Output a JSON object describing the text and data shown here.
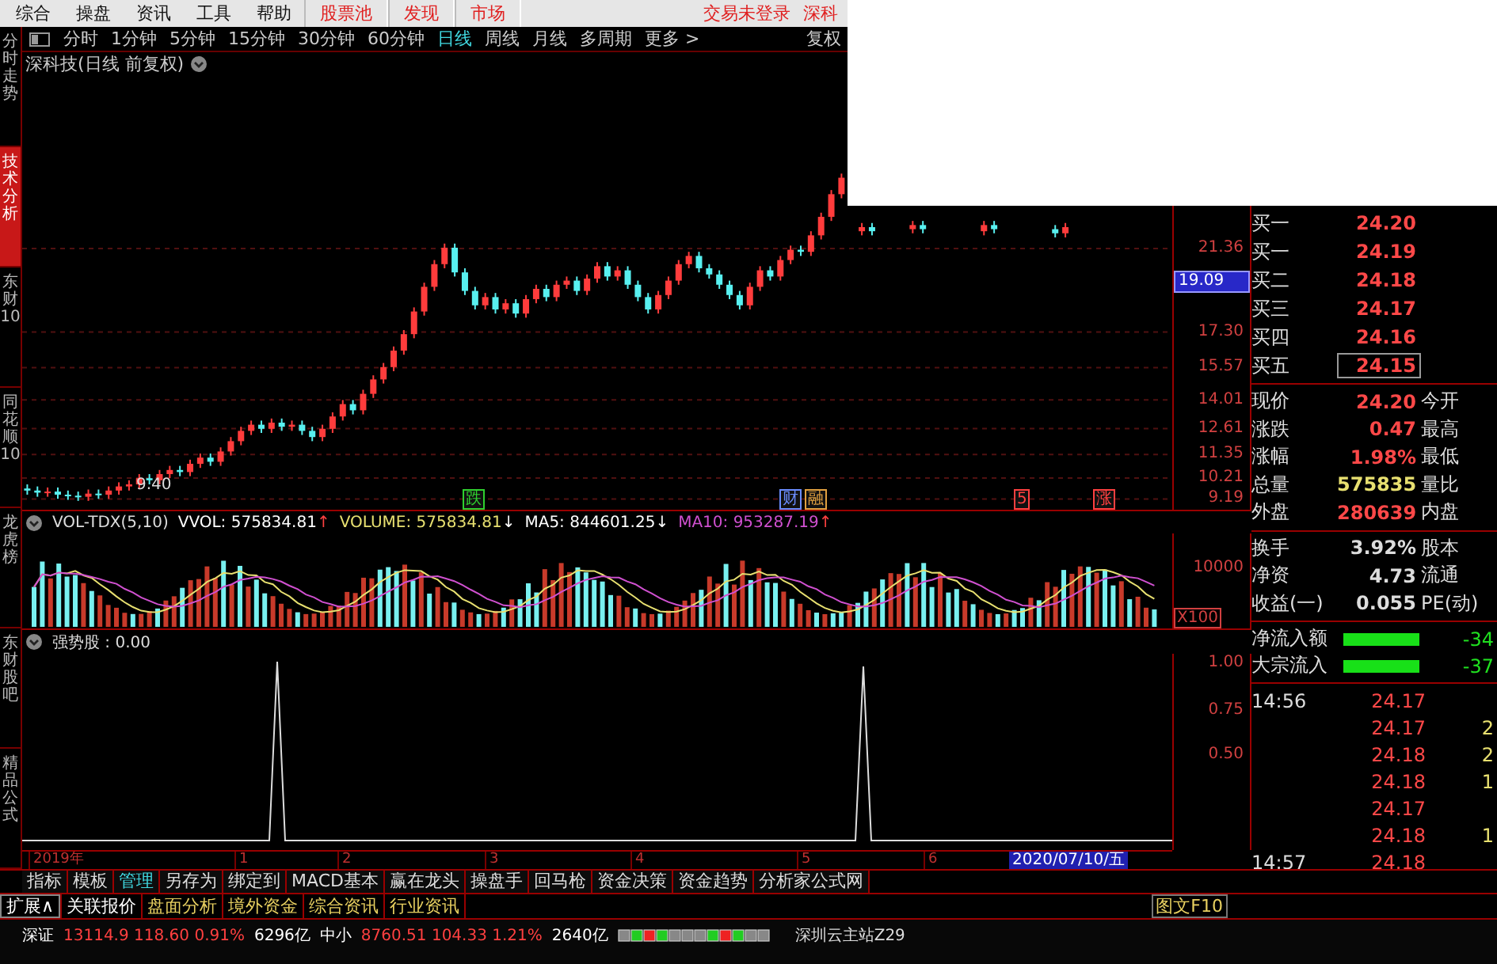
{
  "menu": {
    "items": [
      {
        "label": "综合",
        "kind": "plain"
      },
      {
        "label": "操盘",
        "kind": "plain"
      },
      {
        "label": "资讯",
        "kind": "plain"
      },
      {
        "label": "工具",
        "kind": "plain"
      },
      {
        "label": "帮助",
        "kind": "plain"
      },
      {
        "label": "股票池",
        "kind": "highlight"
      },
      {
        "label": "发现",
        "kind": "highlight"
      },
      {
        "label": "市场",
        "kind": "highlight"
      }
    ],
    "login_status": "交易未登录",
    "cut_item": "深科"
  },
  "side_tabs": [
    {
      "label": "分时走势",
      "selected": false
    },
    {
      "label": "技术分析",
      "selected": true
    },
    {
      "label": "东财10",
      "selected": false
    },
    {
      "label": "同花顺10",
      "selected": false
    },
    {
      "label": "龙虎榜",
      "selected": false
    },
    {
      "label": "东财股吧",
      "selected": false
    },
    {
      "label": "精品公式",
      "selected": false
    }
  ],
  "period_bar": {
    "periods": [
      {
        "label": "分时",
        "selected": false
      },
      {
        "label": "1分钟",
        "selected": false
      },
      {
        "label": "5分钟",
        "selected": false
      },
      {
        "label": "15分钟",
        "selected": false
      },
      {
        "label": "30分钟",
        "selected": false
      },
      {
        "label": "60分钟",
        "selected": false
      },
      {
        "label": "日线",
        "selected": true
      },
      {
        "label": "周线",
        "selected": false
      },
      {
        "label": "月线",
        "selected": false
      },
      {
        "label": "多周期",
        "selected": false
      },
      {
        "label": "更多 >",
        "selected": false
      }
    ],
    "right_label": "复权"
  },
  "chart_title": "深科技(日线 前复权)",
  "price_chart": {
    "low_label": "9.40",
    "markers": [
      {
        "text": "跌",
        "color": "#2fd02f"
      },
      {
        "text": "财",
        "color": "#6a8cff"
      },
      {
        "text": "融",
        "color": "#e0a040"
      },
      {
        "text": "5",
        "color": "#ff4040"
      },
      {
        "text": "涨",
        "color": "#ff4040"
      }
    ],
    "chart_data": {
      "type": "candlestick",
      "grid": true,
      "ylim": [
        8.67,
        29.82
      ],
      "categories": [
        null,
        null,
        null,
        null,
        null,
        null,
        null,
        null,
        null,
        null,
        null,
        null,
        null,
        null,
        null,
        null,
        null,
        null,
        null,
        null,
        null,
        null,
        null,
        null,
        null,
        null,
        null,
        null,
        null,
        null,
        null,
        null,
        null,
        null,
        null,
        null,
        null,
        null,
        null,
        null,
        null,
        null,
        null,
        null,
        null,
        null,
        null,
        null,
        null,
        null,
        null,
        null,
        null,
        null,
        null,
        null,
        null,
        null,
        null,
        null,
        null,
        null,
        null,
        null,
        null,
        null,
        null,
        null,
        null,
        null,
        null,
        null,
        null,
        null,
        null,
        null,
        null,
        null,
        null,
        null,
        null,
        null,
        null,
        null,
        null,
        null,
        null,
        null,
        null,
        null,
        null,
        null,
        null,
        null,
        null,
        null,
        null,
        null,
        null,
        null,
        null,
        null,
        null,
        null,
        null,
        null,
        null,
        null,
        null,
        null,
        null,
        null,
        null
      ],
      "ohlc": [
        [
          9.7,
          9.9,
          9.4,
          9.6
        ],
        [
          9.6,
          9.8,
          9.3,
          9.5
        ],
        [
          9.5,
          9.75,
          9.3,
          9.55
        ],
        [
          9.55,
          9.75,
          9.2,
          9.4
        ],
        [
          9.4,
          9.6,
          9.15,
          9.35
        ],
        [
          9.35,
          9.55,
          9.1,
          9.3
        ],
        [
          9.3,
          9.65,
          9.1,
          9.45
        ],
        [
          9.45,
          9.65,
          9.2,
          9.4
        ],
        [
          9.4,
          9.8,
          9.2,
          9.6
        ],
        [
          9.6,
          10.0,
          9.4,
          9.8
        ],
        [
          9.8,
          10.1,
          9.6,
          9.9
        ],
        [
          9.9,
          10.4,
          9.7,
          10.2
        ],
        [
          10.2,
          10.4,
          9.9,
          10.1
        ],
        [
          10.1,
          10.6,
          9.9,
          10.4
        ],
        [
          10.4,
          10.8,
          10.2,
          10.6
        ],
        [
          10.6,
          10.8,
          10.3,
          10.5
        ],
        [
          10.5,
          11.1,
          10.3,
          10.9
        ],
        [
          10.9,
          11.4,
          10.7,
          11.2
        ],
        [
          11.2,
          11.4,
          10.8,
          11.0
        ],
        [
          11.0,
          11.7,
          10.8,
          11.5
        ],
        [
          11.5,
          12.2,
          11.3,
          12.0
        ],
        [
          12.0,
          12.7,
          11.8,
          12.5
        ],
        [
          12.5,
          13.0,
          12.3,
          12.8
        ],
        [
          12.8,
          13.0,
          12.4,
          12.6
        ],
        [
          12.6,
          13.1,
          12.4,
          12.9
        ],
        [
          12.9,
          13.1,
          12.5,
          12.7
        ],
        [
          12.7,
          13.0,
          12.5,
          12.8
        ],
        [
          12.8,
          13.0,
          12.3,
          12.5
        ],
        [
          12.5,
          12.7,
          12.0,
          12.2
        ],
        [
          12.2,
          12.8,
          12.0,
          12.6
        ],
        [
          12.6,
          13.4,
          12.4,
          13.2
        ],
        [
          13.2,
          14.0,
          13.0,
          13.8
        ],
        [
          13.8,
          14.0,
          13.3,
          13.5
        ],
        [
          13.5,
          14.5,
          13.3,
          14.3
        ],
        [
          14.3,
          15.2,
          14.1,
          15.0
        ],
        [
          15.0,
          15.8,
          14.8,
          15.6
        ],
        [
          15.6,
          16.6,
          15.4,
          16.4
        ],
        [
          16.4,
          17.4,
          16.2,
          17.2
        ],
        [
          17.2,
          18.5,
          17.0,
          18.3
        ],
        [
          18.3,
          19.7,
          18.1,
          19.5
        ],
        [
          19.5,
          20.8,
          19.3,
          20.6
        ],
        [
          20.6,
          21.6,
          20.4,
          21.4
        ],
        [
          21.4,
          21.6,
          20.0,
          20.2
        ],
        [
          20.2,
          20.4,
          19.1,
          19.3
        ],
        [
          19.3,
          19.5,
          18.4,
          18.6
        ],
        [
          18.6,
          19.2,
          18.4,
          19.0
        ],
        [
          19.0,
          19.2,
          18.2,
          18.4
        ],
        [
          18.4,
          18.9,
          18.2,
          18.7
        ],
        [
          18.7,
          18.9,
          18.0,
          18.2
        ],
        [
          18.2,
          19.1,
          18.0,
          18.9
        ],
        [
          18.9,
          19.6,
          18.7,
          19.4
        ],
        [
          19.4,
          19.6,
          18.8,
          19.0
        ],
        [
          19.0,
          19.8,
          18.8,
          19.6
        ],
        [
          19.6,
          20.0,
          19.4,
          19.8
        ],
        [
          19.8,
          20.0,
          19.1,
          19.3
        ],
        [
          19.3,
          20.1,
          19.1,
          19.9
        ],
        [
          19.9,
          20.7,
          19.7,
          20.5
        ],
        [
          20.5,
          20.7,
          19.8,
          20.0
        ],
        [
          20.0,
          20.5,
          19.8,
          20.3
        ],
        [
          20.3,
          20.5,
          19.4,
          19.6
        ],
        [
          19.6,
          19.8,
          18.8,
          19.0
        ],
        [
          19.0,
          19.2,
          18.2,
          18.4
        ],
        [
          18.4,
          19.3,
          18.2,
          19.1
        ],
        [
          19.1,
          20.0,
          18.9,
          19.8
        ],
        [
          19.8,
          20.8,
          19.6,
          20.6
        ],
        [
          20.6,
          21.2,
          20.4,
          21.0
        ],
        [
          21.0,
          21.2,
          20.2,
          20.4
        ],
        [
          20.4,
          20.6,
          19.9,
          20.1
        ],
        [
          20.1,
          20.3,
          19.4,
          19.6
        ],
        [
          19.6,
          19.8,
          18.9,
          19.1
        ],
        [
          19.1,
          19.3,
          18.4,
          18.6
        ],
        [
          18.6,
          19.7,
          18.4,
          19.5
        ],
        [
          19.5,
          20.5,
          19.3,
          20.3
        ],
        [
          20.3,
          20.5,
          19.8,
          20.0
        ],
        [
          20.0,
          21.0,
          19.8,
          20.8
        ],
        [
          20.8,
          21.5,
          20.6,
          21.3
        ],
        [
          21.3,
          21.5,
          21.0,
          21.2
        ],
        [
          21.2,
          22.2,
          21.0,
          22.0
        ],
        [
          22.0,
          23.1,
          21.8,
          22.9
        ],
        [
          22.9,
          24.2,
          22.7,
          24.0
        ],
        [
          24.0,
          25.0,
          23.8,
          24.8
        ],
        null,
        [
          22.2,
          22.6,
          22.0,
          22.4
        ],
        [
          22.4,
          22.6,
          22.0,
          22.2
        ],
        null,
        null,
        null,
        [
          22.3,
          22.7,
          22.1,
          22.5
        ],
        [
          22.5,
          22.7,
          22.1,
          22.3
        ],
        null,
        null,
        null,
        null,
        null,
        [
          22.2,
          22.7,
          22.0,
          22.5
        ],
        [
          22.5,
          22.7,
          22.1,
          22.3
        ],
        null,
        null,
        null,
        null,
        null,
        [
          22.3,
          22.5,
          21.9,
          22.1
        ],
        [
          22.1,
          22.6,
          21.9,
          22.4
        ],
        null,
        null,
        null,
        null,
        null,
        null,
        null,
        null,
        null,
        null
      ],
      "yticks": [
        {
          "value": 21.36,
          "label": "21.36"
        },
        {
          "value": 17.3,
          "label": "17.30"
        },
        {
          "value": 15.57,
          "label": "15.57"
        },
        {
          "value": 14.01,
          "label": "14.01"
        },
        {
          "value": 12.61,
          "label": "12.61"
        },
        {
          "value": 11.35,
          "label": "11.35"
        },
        {
          "value": 10.21,
          "label": "10.21"
        },
        {
          "value": 9.19,
          "label": "9.19"
        }
      ]
    },
    "cursor_price": "19.09"
  },
  "volume_panel": {
    "name": "VOL-TDX(5,10)",
    "readouts": [
      {
        "label": "VVOL: 575834.81",
        "color": "#ffffff",
        "arrow": {
          "text": "↑",
          "color": "#ff4040"
        }
      },
      {
        "label": "VOLUME: 575834.81",
        "color": "#e8e070",
        "arrow": {
          "text": "↓",
          "color": "#ffffff"
        }
      },
      {
        "label": "MA5: 844601.25",
        "color": "#ffffff",
        "arrow": {
          "text": "↓",
          "color": "#ffffff"
        }
      },
      {
        "label": "MA10: 953287.19",
        "color": "#d050d0",
        "arrow": {
          "text": "↑",
          "color": "#ff4040"
        }
      }
    ],
    "axis_ticks": [
      "10000"
    ],
    "unit": "X100"
  },
  "indicator_panel": {
    "name": "强势股 : 0.00",
    "axis_ticks": [
      "1.00",
      "0.75",
      "0.50"
    ]
  },
  "time_axis": {
    "labels": [
      "2019年",
      "1",
      "2",
      "3",
      "4",
      "5",
      "6"
    ],
    "current_date": "2020/07/10/五"
  },
  "quote": {
    "orders": [
      {
        "label": "买一",
        "price": "24.20",
        "selected": false
      },
      {
        "label": "买一",
        "price": "24.19",
        "selected": false
      },
      {
        "label": "买二",
        "price": "24.18",
        "selected": false
      },
      {
        "label": "买三",
        "price": "24.17",
        "selected": false
      },
      {
        "label": "买四",
        "price": "24.16",
        "selected": false
      },
      {
        "label": "买五",
        "price": "24.15",
        "selected": true
      }
    ],
    "stats": [
      {
        "label": "现价",
        "value": "24.20",
        "color": "#ff4848",
        "extra": "今开"
      },
      {
        "label": "涨跌",
        "value": "0.47",
        "color": "#ff4848",
        "extra": "最高"
      },
      {
        "label": "涨幅",
        "value": "1.98%",
        "color": "#ff4848",
        "extra": "最低"
      },
      {
        "label": "总量",
        "value": "575835",
        "color": "#e8e070",
        "extra": "量比"
      },
      {
        "label": "外盘",
        "value": "280639",
        "color": "#ff4848",
        "extra": "内盘"
      }
    ],
    "fundamentals": [
      {
        "label": "换手",
        "value": "3.92%",
        "extra": "股本"
      },
      {
        "label": "净资",
        "value": "4.73",
        "extra": "流通"
      },
      {
        "label": "收益(一)",
        "value": "0.055",
        "extra": "PE(动)"
      }
    ],
    "flows": [
      {
        "label": "净流入额",
        "value": "-34"
      },
      {
        "label": "大宗流入",
        "value": "-37"
      }
    ],
    "ticks": [
      {
        "time": "14:56",
        "price": "24.17"
      },
      {
        "price": "24.17",
        "volume": "2"
      },
      {
        "price": "24.18",
        "volume": "2"
      },
      {
        "price": "24.18",
        "volume": "1"
      },
      {
        "price": "24.17"
      },
      {
        "price": "24.18",
        "volume": "1"
      },
      {
        "time": "14:57",
        "price": "24.18"
      }
    ]
  },
  "formula_tabs": [
    {
      "label": "指标",
      "selected": false
    },
    {
      "label": "模板",
      "selected": false
    },
    {
      "label": "管理",
      "selected": true
    },
    {
      "label": "另存为",
      "selected": false
    },
    {
      "label": "绑定到",
      "selected": false
    },
    {
      "label": "MACD基本",
      "selected": false
    },
    {
      "label": "赢在龙头",
      "selected": false
    },
    {
      "label": "操盘手",
      "selected": false
    },
    {
      "label": "回马枪",
      "selected": false
    },
    {
      "label": "资金决策",
      "selected": false
    },
    {
      "label": "资金趋势",
      "selected": false
    },
    {
      "label": "分析家公式网",
      "selected": false
    }
  ],
  "extension_bar": {
    "items": [
      {
        "label": "扩展∧",
        "kind": "toggle"
      },
      {
        "label": "关联报价",
        "kind": "plain"
      },
      {
        "label": "盘面分析",
        "kind": "feature"
      },
      {
        "label": "境外资金",
        "kind": "feature"
      },
      {
        "label": "综合资讯",
        "kind": "feature"
      },
      {
        "label": "行业资讯",
        "kind": "feature"
      }
    ],
    "right_label": "图文F10"
  },
  "status_bar": {
    "items": [
      {
        "text": "深证",
        "color": "#ffffff"
      },
      {
        "text": "13114.9 118.60 0.91%",
        "color": "#ff4040"
      },
      {
        "text": "6296亿",
        "color": "#ffffff"
      },
      {
        "text": "中小",
        "color": "#ffffff"
      },
      {
        "text": "8760.51 104.33 1.21%",
        "color": "#ff4040"
      },
      {
        "text": "2640亿",
        "color": "#ffffff"
      }
    ],
    "server": "深圳云主站Z29"
  }
}
